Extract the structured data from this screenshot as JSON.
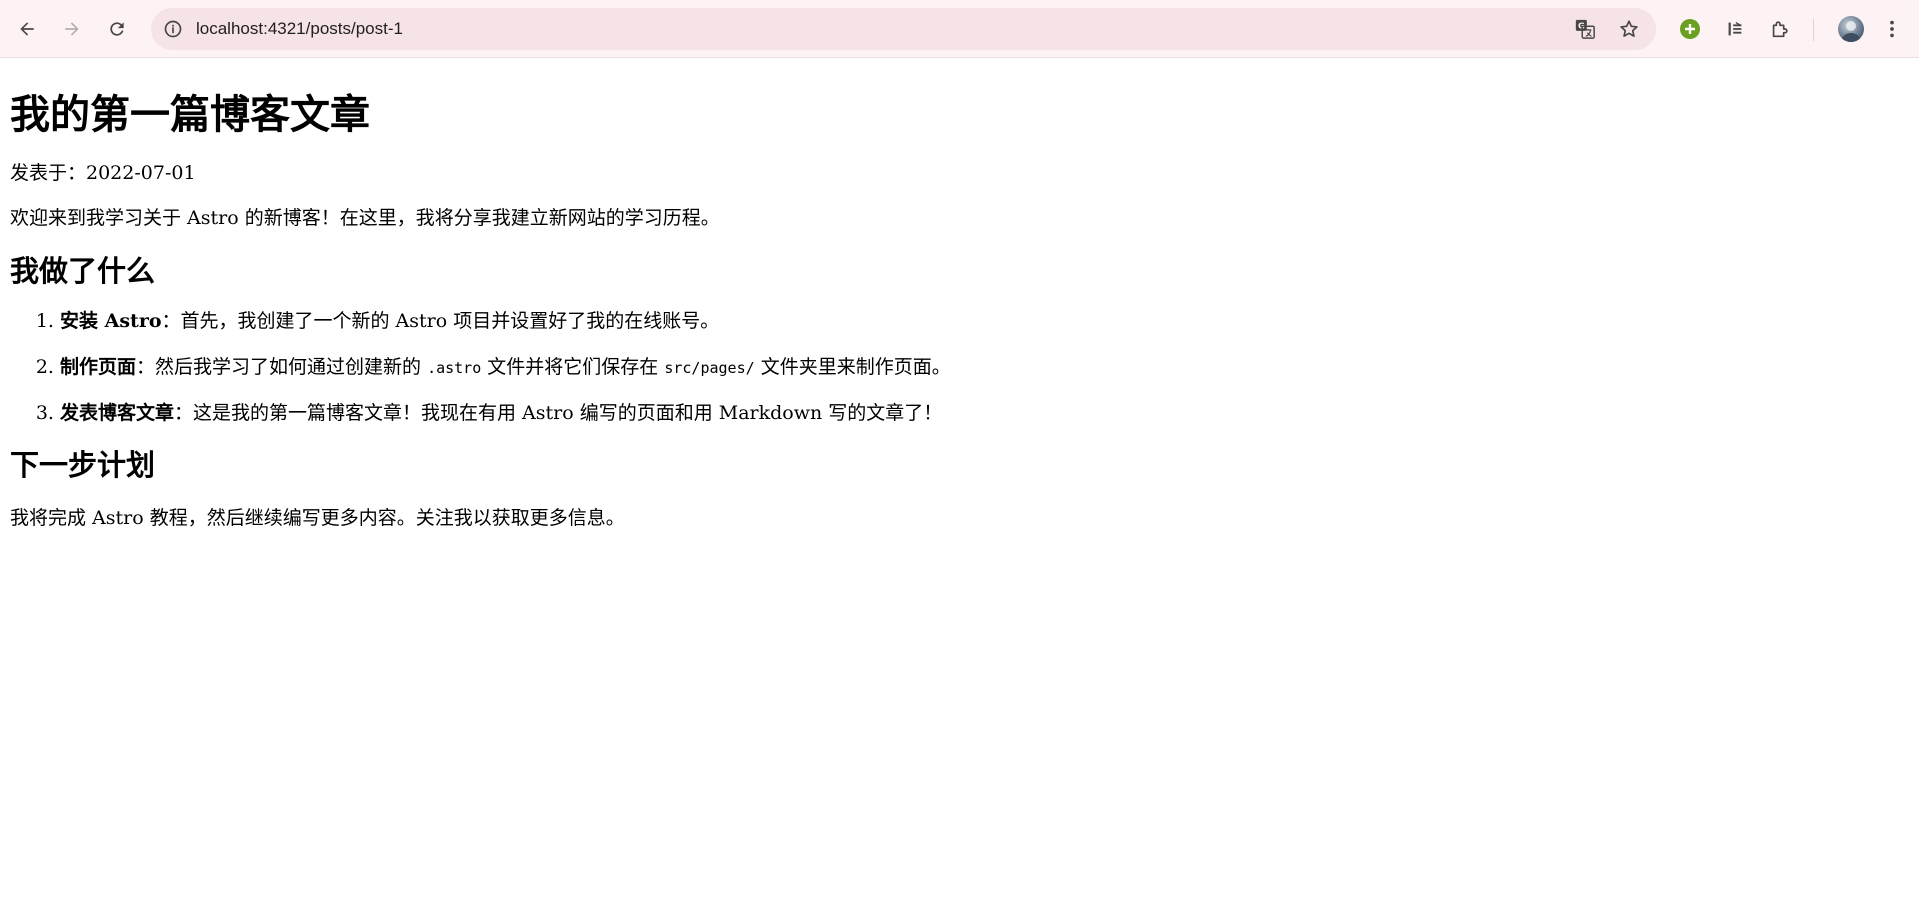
{
  "browser": {
    "url": "localhost:4321/posts/post-1"
  },
  "icons": {
    "back": "back-arrow-icon",
    "forward": "forward-arrow-icon",
    "reload": "reload-icon",
    "site_info": "info-circle-icon",
    "translate": "translate-icon",
    "bookmark": "star-icon",
    "extension_1": "green-plus-extension-icon",
    "extension_2": "reader-extension-icon",
    "extensions": "puzzle-icon",
    "profile": "avatar",
    "menu": "kebab-menu-icon"
  },
  "colors": {
    "chrome_bg": "#fdf3f4",
    "omnibox_bg": "#f5e3e6",
    "extension_green": "#6aa022"
  },
  "post": {
    "title": "我的第一篇博客文章",
    "meta": "发表于：2022-07-01",
    "intro": "欢迎来到我学习关于 Astro 的新博客！在这里，我将分享我建立新网站的学习历程。",
    "section1_title": "我做了什么",
    "items": [
      {
        "strong": "安装 Astro",
        "text": "：首先，我创建了一个新的 Astro 项目并设置好了我的在线账号。"
      },
      {
        "strong": "制作页面",
        "text_before": "：然后我学习了如何通过创建新的 ",
        "code1": ".astro",
        "text_mid": " 文件并将它们保存在 ",
        "code2": "src/pages/",
        "text_after": " 文件夹里来制作页面。"
      },
      {
        "strong": "发表博客文章",
        "text": "：这是我的第一篇博客文章！我现在有用 Astro 编写的页面和用 Markdown 写的文章了！"
      }
    ],
    "section2_title": "下一步计划",
    "outro": "我将完成 Astro 教程，然后继续编写更多内容。关注我以获取更多信息。"
  }
}
